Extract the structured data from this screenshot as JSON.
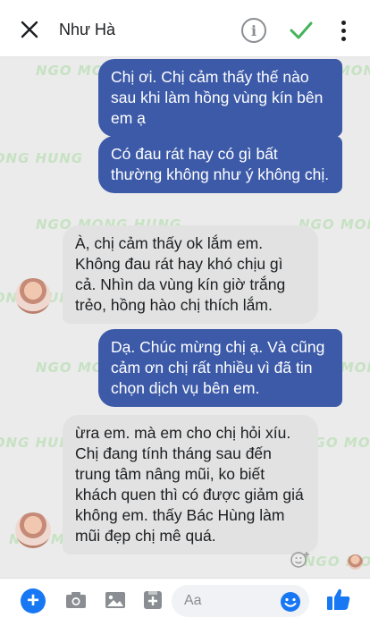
{
  "header": {
    "title": "Như Hà",
    "info_glyph": "i",
    "icons": [
      "close-icon",
      "info-icon",
      "check-icon",
      "more-vertical-icon"
    ]
  },
  "watermark": "NGO MONG HUNG",
  "messages": [
    {
      "direction": "outgoing",
      "text": "Chị ơi. Chị cảm thấy thế nào sau khi làm hồng vùng kín bên em ạ"
    },
    {
      "direction": "outgoing",
      "text": "Có đau rát hay có gì bất thường không như ý không chị."
    },
    {
      "direction": "incoming",
      "text": "À, chị cảm thấy ok lắm em. Không đau rát hay khó chịu gì cả. Nhìn da vùng kín giờ trắng trẻo, hồng hào chị thích lắm."
    },
    {
      "direction": "outgoing",
      "text": "Dạ. Chúc mừng chị ạ. Và cũng cảm ơn chị rất nhiều vì đã tin chọn dịch vụ bên em."
    },
    {
      "direction": "incoming",
      "text": "ừra em. mà em cho chị hỏi xíu. Chị đang tính tháng sau đến trung tâm nâng mũi, ko biết khách quen thì có được giảm giá không em. thấy Bác Hùng làm mũi đẹp chị mê quá."
    }
  ],
  "composer": {
    "placeholder": "Aa",
    "icons": [
      "plus-icon",
      "camera-icon",
      "image-icon",
      "sticker-icon",
      "emoji-icon",
      "like-icon"
    ]
  },
  "colors": {
    "outgoing_bubble": "#3c5aa8",
    "incoming_bubble": "#e2e2e2",
    "chat_background": "#ebebeb",
    "accent": "#1877f2",
    "check": "#44b35a"
  }
}
